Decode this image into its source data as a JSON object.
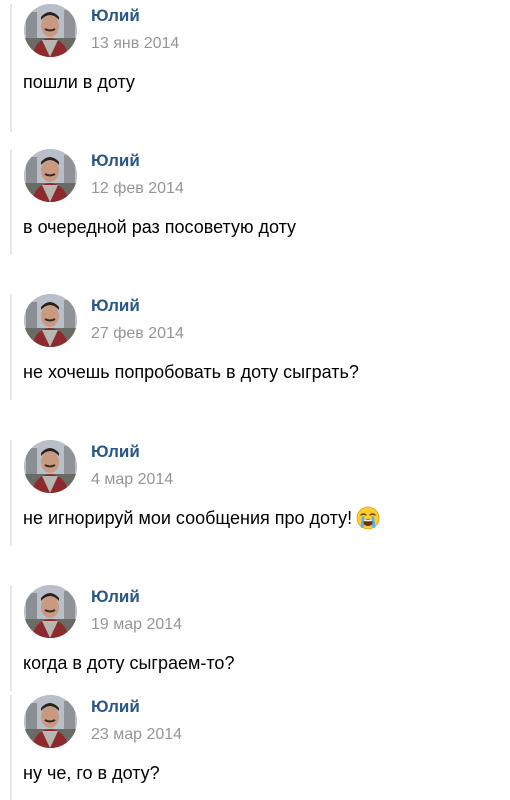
{
  "posts": [
    {
      "author": "Юлий",
      "date": "13 янв 2014",
      "text": "пошли в доту"
    },
    {
      "author": "Юлий",
      "date": "12 фев 2014",
      "text": "в очередной раз посоветую доту"
    },
    {
      "author": "Юлий",
      "date": "27 фев 2014",
      "text": "не хочешь попробовать в доту сыграть?"
    },
    {
      "author": "Юлий",
      "date": "4 мар 2014",
      "text": "не игнорируй мои сообщения про доту!",
      "emoji": "loudly-crying-face-icon"
    },
    {
      "author": "Юлий",
      "date": "19 мар 2014",
      "text": "когда в доту сыграем-то?"
    },
    {
      "author": "Юлий",
      "date": "23 мар 2014",
      "text": "ну че, го в доту?"
    }
  ],
  "colors": {
    "author": "#2a5885",
    "date": "#939699",
    "text": "#000000",
    "rule": "#e7e8ec"
  }
}
